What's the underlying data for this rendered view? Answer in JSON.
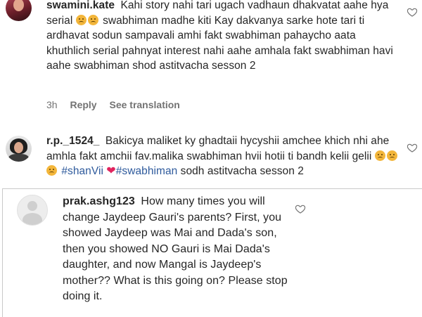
{
  "comments": [
    {
      "username": "swamini.kate",
      "segments": [
        "Kahi story nahi tari ugach vadhaun dhakvatat aahe hya serial",
        "swabhiman madhe kiti Kay dakvanya sarke hote tari ti ardhavat sodun sampavali amhi fakt swabhiman pahaycho aata khuthlich serial pahnyat interest nahi aahe amhala fakt swabhiman havi aahe swabhiman shod astitvacha sesson 2"
      ],
      "time": "3h",
      "reply_label": "Reply",
      "translate_label": "See translation",
      "like_icon": "heart-outline-icon"
    },
    {
      "username": "r.p._1524_",
      "text": "Bakicya maliket ky ghadtaii hycyshii amchee khich nhi ahe amhla fakt amchii fav.malika swabhiman hvii hotii ti bandh kelii gelii",
      "hashtag1": "#shanVii",
      "hashtag2": "#swabhiman",
      "tail": "sodh astitvacha sesson 2",
      "like_icon": "heart-outline-icon"
    },
    {
      "username": "prak.ashg123",
      "text": "How many times you will change Jaydeep Gauri's parents? First, you showed Jaydeep was Mai and Dada's son, then you showed NO Gauri is Mai Dada's daughter, and now Mangal is Jaydeep's mother?? What is this going on? Please stop doing it.",
      "like_icon": "heart-outline-icon"
    }
  ]
}
